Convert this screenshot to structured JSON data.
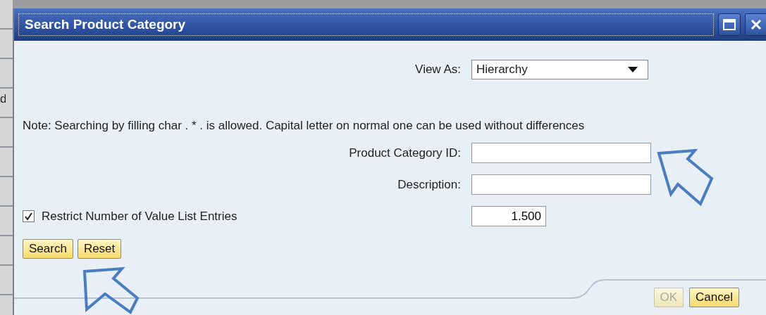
{
  "window": {
    "title": "Search Product Category"
  },
  "background_text": "d",
  "view_as": {
    "label": "View As:",
    "value": "Hierarchy"
  },
  "note": "Note: Searching by filling char . * . is allowed. Capital letter on normal one can be used without differences",
  "fields": [
    {
      "label": "Product Category ID:"
    },
    {
      "label": "Description:"
    }
  ],
  "restrict": {
    "label": "Restrict Number of Value List Entries",
    "checked": true,
    "value": "1.500"
  },
  "buttons": [
    {
      "label": "Search"
    },
    {
      "label": "Reset"
    }
  ],
  "footer_buttons": [
    {
      "label": "OK",
      "disabled": true
    },
    {
      "label": "Cancel",
      "disabled": false
    }
  ]
}
